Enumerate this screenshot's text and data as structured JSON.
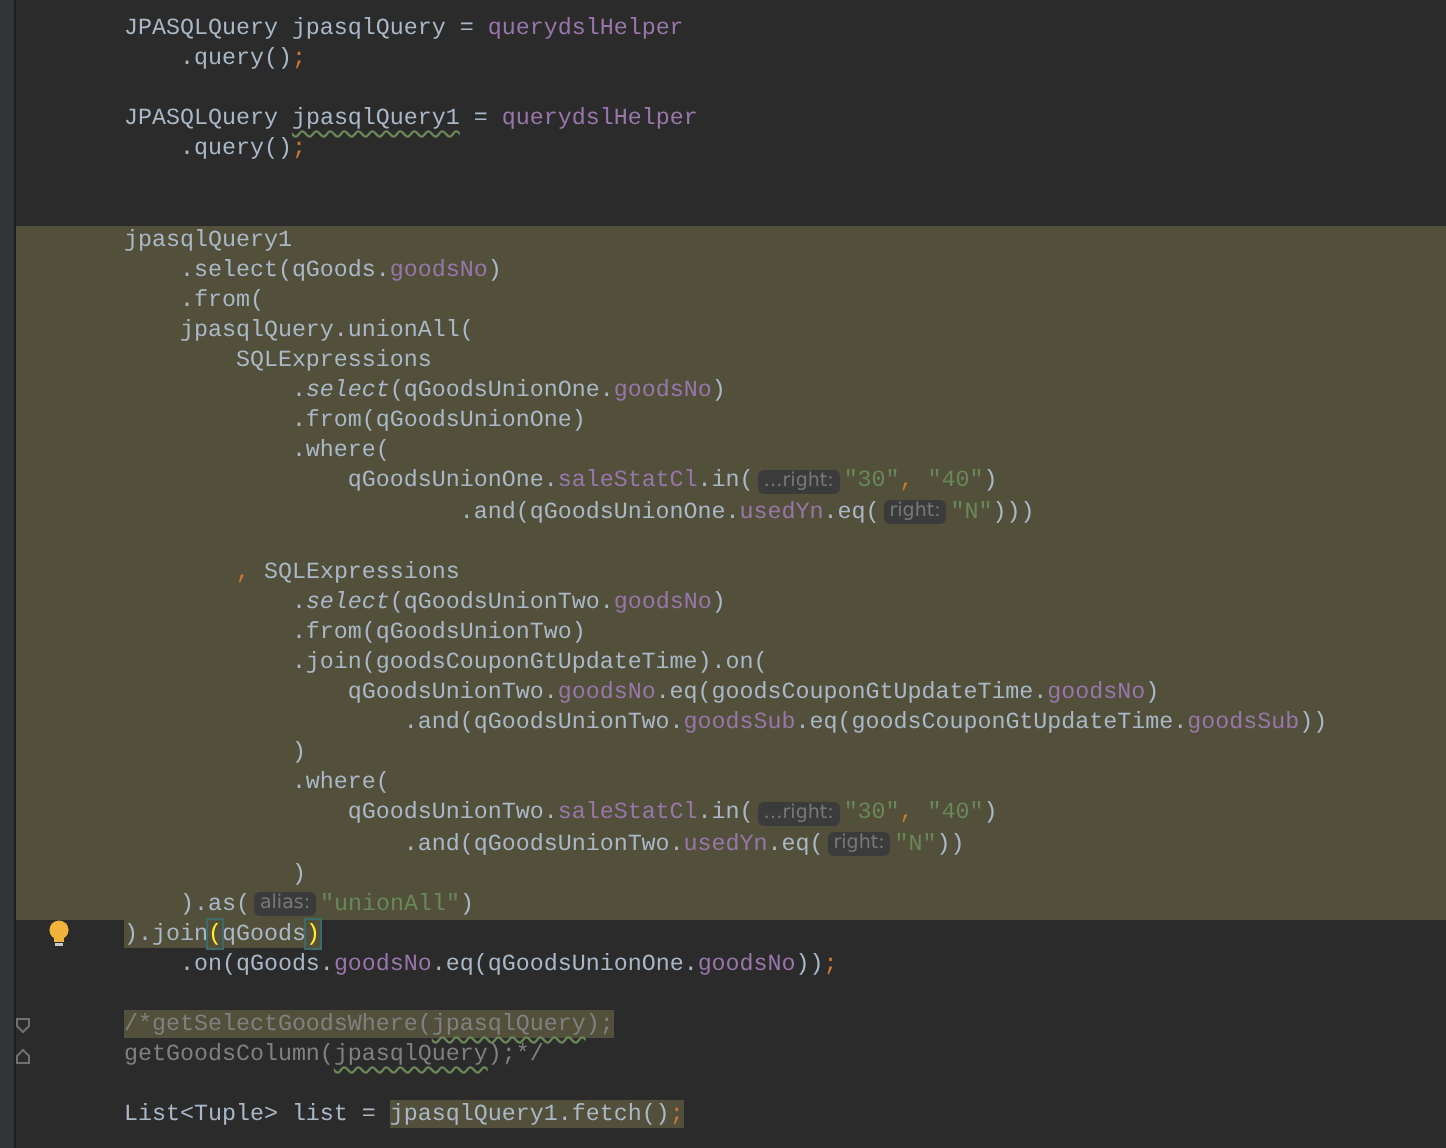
{
  "lines": [
    {
      "highlighted": false,
      "tokens": [
        {
          "text": "JPASQLQuery jpasqlQuery = ",
          "kind": "text"
        },
        {
          "text": "querydslHelper",
          "kind": "field"
        }
      ]
    },
    {
      "highlighted": false,
      "tokens": [
        {
          "text": "    .query()",
          "kind": "text"
        },
        {
          "text": ";",
          "kind": "keyword"
        }
      ]
    },
    {
      "highlighted": false
    },
    {
      "highlighted": false,
      "tokens": [
        {
          "text": "JPASQLQuery ",
          "kind": "text"
        },
        {
          "text": "jpasqlQuery1",
          "kind": "text",
          "warning": true
        },
        {
          "text": " = ",
          "kind": "text"
        },
        {
          "text": "querydslHelper",
          "kind": "field"
        }
      ]
    },
    {
      "highlighted": false,
      "tokens": [
        {
          "text": "    .query()",
          "kind": "text"
        },
        {
          "text": ";",
          "kind": "keyword"
        }
      ]
    },
    {
      "highlighted": false
    },
    {
      "highlighted": false
    },
    {
      "highlighted": true,
      "tokens": [
        {
          "text": "jpasqlQuery1",
          "kind": "text"
        }
      ]
    },
    {
      "highlighted": true,
      "tokens": [
        {
          "text": "    .select(qGoods.",
          "kind": "text"
        },
        {
          "text": "goodsNo",
          "kind": "field"
        },
        {
          "text": ")",
          "kind": "text"
        }
      ]
    },
    {
      "highlighted": true,
      "tokens": [
        {
          "text": "    .from(",
          "kind": "text"
        }
      ]
    },
    {
      "highlighted": true,
      "tokens": [
        {
          "text": "    jpasqlQuery.unionAll(",
          "kind": "text"
        }
      ]
    },
    {
      "highlighted": true,
      "tokens": [
        {
          "text": "        SQLExpressions",
          "kind": "text"
        }
      ]
    },
    {
      "highlighted": true,
      "tokens": [
        {
          "text": "            .",
          "kind": "text"
        },
        {
          "text": "select",
          "kind": "static"
        },
        {
          "text": "(qGoodsUnionOne.",
          "kind": "text"
        },
        {
          "text": "goodsNo",
          "kind": "field"
        },
        {
          "text": ")",
          "kind": "text"
        }
      ]
    },
    {
      "highlighted": true,
      "tokens": [
        {
          "text": "            .from(qGoodsUnionOne)",
          "kind": "text"
        }
      ]
    },
    {
      "highlighted": true,
      "tokens": [
        {
          "text": "            .where(",
          "kind": "text"
        }
      ]
    },
    {
      "highlighted": true,
      "tokens": [
        {
          "text": "                qGoodsUnionOne.",
          "kind": "text"
        },
        {
          "text": "saleStatCl",
          "kind": "field"
        },
        {
          "text": ".in(",
          "kind": "text"
        },
        {
          "text": "…right:",
          "kind": "hint"
        },
        {
          "text": "\"30\"",
          "kind": "string"
        },
        {
          "text": ",",
          "kind": "keyword"
        },
        {
          "text": " \"40\"",
          "kind": "string"
        },
        {
          "text": ")",
          "kind": "text"
        }
      ]
    },
    {
      "highlighted": true,
      "tokens": [
        {
          "text": "                        .and(qGoodsUnionOne.",
          "kind": "text"
        },
        {
          "text": "usedYn",
          "kind": "field"
        },
        {
          "text": ".eq(",
          "kind": "text"
        },
        {
          "text": "right:",
          "kind": "hint"
        },
        {
          "text": "\"N\"",
          "kind": "string"
        },
        {
          "text": ")))",
          "kind": "text"
        }
      ]
    },
    {
      "highlighted": true
    },
    {
      "highlighted": true,
      "tokens": [
        {
          "text": "        ,",
          "kind": "keyword"
        },
        {
          "text": " SQLExpressions",
          "kind": "text"
        }
      ]
    },
    {
      "highlighted": true,
      "tokens": [
        {
          "text": "            .",
          "kind": "text"
        },
        {
          "text": "select",
          "kind": "static"
        },
        {
          "text": "(qGoodsUnionTwo.",
          "kind": "text"
        },
        {
          "text": "goodsNo",
          "kind": "field"
        },
        {
          "text": ")",
          "kind": "text"
        }
      ]
    },
    {
      "highlighted": true,
      "tokens": [
        {
          "text": "            .from(qGoodsUnionTwo)",
          "kind": "text"
        }
      ]
    },
    {
      "highlighted": true,
      "tokens": [
        {
          "text": "            .join(goodsCouponGtUpdateTime).on(",
          "kind": "text"
        }
      ]
    },
    {
      "highlighted": true,
      "tokens": [
        {
          "text": "                qGoodsUnionTwo.",
          "kind": "text"
        },
        {
          "text": "goodsNo",
          "kind": "field"
        },
        {
          "text": ".eq(goodsCouponGtUpdateTime.",
          "kind": "text"
        },
        {
          "text": "goodsNo",
          "kind": "field"
        },
        {
          "text": ")",
          "kind": "text"
        }
      ]
    },
    {
      "highlighted": true,
      "tokens": [
        {
          "text": "                    .and(qGoodsUnionTwo.",
          "kind": "text"
        },
        {
          "text": "goodsSub",
          "kind": "field"
        },
        {
          "text": ".eq(goodsCouponGtUpdateTime.",
          "kind": "text"
        },
        {
          "text": "goodsSub",
          "kind": "field"
        },
        {
          "text": "))",
          "kind": "text"
        }
      ]
    },
    {
      "highlighted": true,
      "tokens": [
        {
          "text": "            )",
          "kind": "text"
        }
      ]
    },
    {
      "highlighted": true,
      "tokens": [
        {
          "text": "            .where(",
          "kind": "text"
        }
      ]
    },
    {
      "highlighted": true,
      "tokens": [
        {
          "text": "                qGoodsUnionTwo.",
          "kind": "text"
        },
        {
          "text": "saleStatCl",
          "kind": "field"
        },
        {
          "text": ".in(",
          "kind": "text"
        },
        {
          "text": "…right:",
          "kind": "hint"
        },
        {
          "text": "\"30\"",
          "kind": "string"
        },
        {
          "text": ",",
          "kind": "keyword"
        },
        {
          "text": " \"40\"",
          "kind": "string"
        },
        {
          "text": ")",
          "kind": "text"
        }
      ]
    },
    {
      "highlighted": true,
      "tokens": [
        {
          "text": "                    .and(qGoodsUnionTwo.",
          "kind": "text"
        },
        {
          "text": "usedYn",
          "kind": "field"
        },
        {
          "text": ".eq(",
          "kind": "text"
        },
        {
          "text": "right:",
          "kind": "hint"
        },
        {
          "text": "\"N\"",
          "kind": "string"
        },
        {
          "text": "))",
          "kind": "text"
        }
      ]
    },
    {
      "highlighted": true,
      "tokens": [
        {
          "text": "            )",
          "kind": "text"
        }
      ]
    },
    {
      "highlighted": true,
      "tokens": [
        {
          "text": "    ).as(",
          "kind": "text"
        },
        {
          "text": "alias:",
          "kind": "hint"
        },
        {
          "text": "\"unionAll\"",
          "kind": "string"
        },
        {
          "text": ")",
          "kind": "text"
        }
      ]
    },
    {
      "highlighted": false,
      "kind": "lightbulb",
      "tokens": [
        {
          "text": ").join",
          "kind": "text",
          "highlighted": true
        },
        {
          "text": "(",
          "kind": "text",
          "highlighted": true,
          "matched": true
        },
        {
          "text": "qGoods",
          "kind": "text",
          "highlighted": true
        },
        {
          "text": ")",
          "kind": "text",
          "highlighted": true,
          "matched": true
        }
      ]
    },
    {
      "highlighted": false,
      "tokens": [
        {
          "text": "    .on(qGoods.",
          "kind": "text"
        },
        {
          "text": "goodsNo",
          "kind": "field"
        },
        {
          "text": ".eq(qGoodsUnionOne.",
          "kind": "text"
        },
        {
          "text": "goodsNo",
          "kind": "field"
        },
        {
          "text": "))",
          "kind": "text"
        },
        {
          "text": ";",
          "kind": "keyword"
        }
      ]
    },
    {
      "highlighted": false
    },
    {
      "highlighted": false,
      "kind": "fold-start",
      "tokens": [
        {
          "text": "/*getSelectGoodsWhere(",
          "kind": "comment",
          "highlighted": true
        },
        {
          "text": "jpasqlQuery",
          "kind": "comment",
          "highlighted": true,
          "warning": true
        },
        {
          "text": ");",
          "kind": "comment",
          "highlighted": true
        }
      ]
    },
    {
      "highlighted": false,
      "kind": "fold-end",
      "tokens": [
        {
          "text": "getGoodsColumn(",
          "kind": "comment"
        },
        {
          "text": "jpasqlQuery",
          "kind": "comment",
          "warning": true
        },
        {
          "text": ");*/",
          "kind": "comment"
        }
      ]
    },
    {
      "highlighted": false
    },
    {
      "highlighted": false,
      "tokens": [
        {
          "text": "List<Tuple> list = ",
          "kind": "text"
        },
        {
          "text": "jpasqlQuery1.fetch()",
          "kind": "text",
          "highlighted": true
        },
        {
          "text": ";",
          "kind": "keyword",
          "highlighted": true
        }
      ]
    }
  ]
}
